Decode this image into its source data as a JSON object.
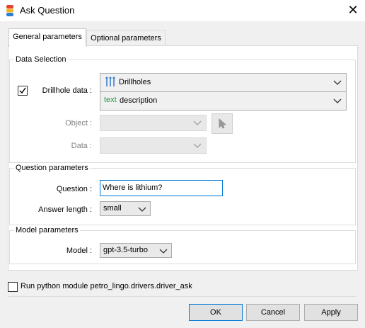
{
  "window": {
    "title": "Ask Question"
  },
  "tabs": [
    {
      "label": "General parameters",
      "active": true
    },
    {
      "label": "Optional parameters",
      "active": false
    }
  ],
  "data_selection": {
    "title": "Data Selection",
    "drillhole_label": "Drillhole data :",
    "drillhole_checked": true,
    "drillhole_value": "Drillholes",
    "drillhole_icon": "drillhole-icon",
    "field_prefix": "text",
    "field_value": "description",
    "object_label": "Object :",
    "data_label": "Data :"
  },
  "question_params": {
    "title": "Question parameters",
    "question_label": "Question :",
    "question_value": "Where is lithium?",
    "answer_length_label": "Answer length :",
    "answer_length_value": "small"
  },
  "model_params": {
    "title": "Model parameters",
    "model_label": "Model :",
    "model_value": "gpt-3.5-turbo"
  },
  "run_python": {
    "checked": false,
    "label": "Run python module petro_lingo.drivers.driver_ask"
  },
  "buttons": {
    "ok": "OK",
    "cancel": "Cancel",
    "apply": "Apply"
  },
  "colors": {
    "accent": "#0078d7",
    "text_green": "#2e9a4a",
    "drillhole_icon": "#3b7fd1"
  }
}
